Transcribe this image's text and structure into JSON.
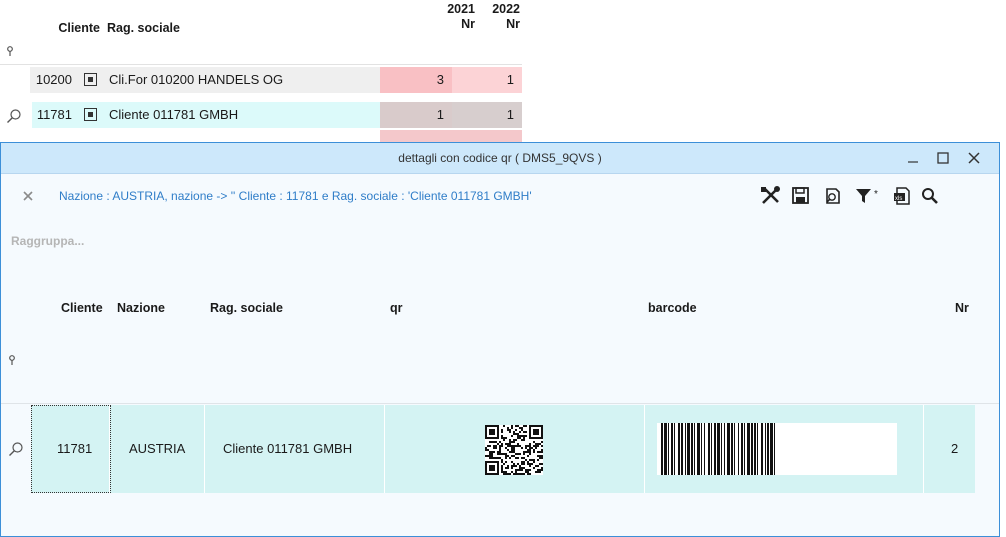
{
  "background_grid": {
    "headers": {
      "cliente": "Cliente",
      "rag_sociale": "Rag. sociale"
    },
    "years": [
      {
        "year": "2021",
        "unit": "Nr"
      },
      {
        "year": "2022",
        "unit": "Nr"
      }
    ],
    "rows": [
      {
        "cliente": "10200",
        "rag_sociale": "Cli.For 010200 HANDELS OG",
        "v2021": "3",
        "v2022": "1",
        "v2021_color": "#f9c0c4",
        "v2022_color": "#fcd3d6"
      },
      {
        "cliente": "11781",
        "rag_sociale": "Cliente 011781 GMBH",
        "v2021": "1",
        "v2022": "1",
        "v2021_color": "#d9cbcb",
        "v2022_color": "#d7cece"
      }
    ]
  },
  "dialog": {
    "title": "dettagli con codice qr ( DMS5_9QVS  )",
    "filter_info": "Nazione : AUSTRIA, nazione -> '' Cliente : 11781 e Rag. sociale : 'Cliente 011781 GMBH'",
    "group_placeholder": "Raggruppa...",
    "toolbar_icons": [
      "tools-icon",
      "save-icon",
      "refresh-icon",
      "filter-icon",
      "excel-export-icon",
      "search-icon"
    ],
    "grid": {
      "headers": {
        "cliente": "Cliente",
        "nazione": "Nazione",
        "rag_sociale": "Rag. sociale",
        "qr": "qr",
        "barcode": "barcode",
        "nr": "Nr"
      },
      "row": {
        "cliente": "11781",
        "nazione": "AUSTRIA",
        "rag_sociale": "Cliente 011781 GMBH",
        "nr": "2"
      }
    }
  },
  "colors": {
    "accent_blue": "#2f7dc8",
    "title_bar": "#cde8fb",
    "row_highlight_cyan": "#d4f3f3",
    "bg_row_cyan": "#dcfafa"
  }
}
